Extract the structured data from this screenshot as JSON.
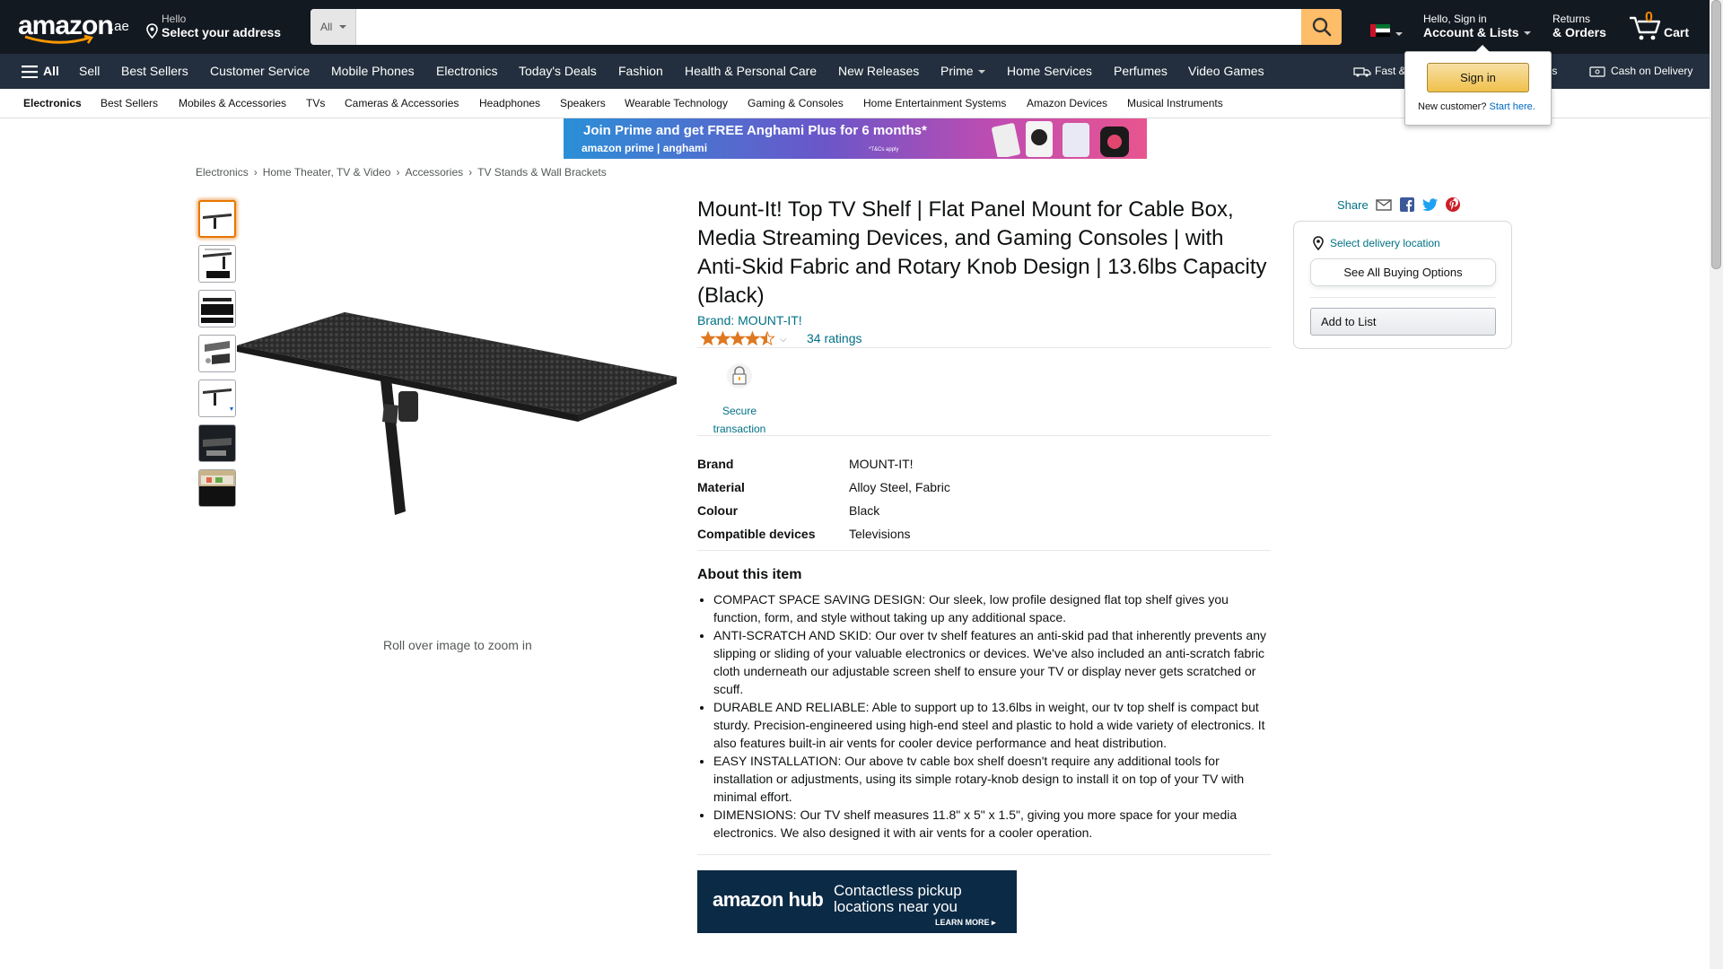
{
  "header": {
    "logo_text": "amazon",
    "logo_tld": ".ae",
    "deliver_hello": "Hello",
    "deliver_address": "Select your address",
    "search_category": "All",
    "search_placeholder": "",
    "account_hello": "Hello, Sign in",
    "account_lists": "Account & Lists",
    "returns_l1": "Returns",
    "returns_l2": "& Orders",
    "cart_count": "0",
    "cart_label": "Cart"
  },
  "main_nav": {
    "all_label": "All",
    "items": [
      "Sell",
      "Best Sellers",
      "Customer Service",
      "Mobile Phones",
      "Electronics",
      "Today's Deals",
      "Fashion",
      "Health & Personal Care",
      "New Releases",
      "Prime",
      "Home Services",
      "Perfumes",
      "Video Games"
    ],
    "fast_delivery": "Fast &",
    "returns_partial": "urns",
    "cash_on_delivery": "Cash on Delivery"
  },
  "subnav": {
    "items": [
      "Electronics",
      "Best Sellers",
      "Mobiles & Accessories",
      "TVs",
      "Cameras & Accessories",
      "Headphones",
      "Speakers",
      "Wearable Technology",
      "Gaming & Consoles",
      "Home Entertainment Systems",
      "Amazon Devices",
      "Musical Instruments"
    ]
  },
  "banner": {
    "line1": "Join Prime and get FREE Anghami Plus for 6 months*",
    "line2": "amazon prime | anghami",
    "terms": "*T&Cs apply"
  },
  "breadcrumb": [
    "Electronics",
    "Home Theater, TV & Video",
    "Accessories",
    "TV Stands & Wall Brackets"
  ],
  "product": {
    "title": "Mount-It! Top TV Shelf | Flat Panel Mount for Cable Box, Media Streaming Devices, and Gaming Consoles | with Anti-Skid Fabric and Rotary Knob Design | 13.6lbs Capacity (Black)",
    "brand_link": "Brand: MOUNT-IT!",
    "rating_value": 4.5,
    "rating_count": "34 ratings",
    "secure_label": "Secure transaction",
    "zoom_hint": "Roll over image to zoom in",
    "specs": [
      {
        "key": "Brand",
        "value": "MOUNT-IT!"
      },
      {
        "key": "Material",
        "value": "Alloy Steel, Fabric"
      },
      {
        "key": "Colour",
        "value": "Black"
      },
      {
        "key": "Compatible devices",
        "value": "Televisions"
      }
    ],
    "about_heading": "About this item",
    "about": [
      "COMPACT SPACE SAVING DESIGN: Our sleek, low profile designed flat top shelf gives you function, form, and style without taking up any additional space.",
      "ANTI-SCRATCH AND SKID: Our over tv shelf features an anti-skid pad that inherently prevents any slipping or sliding of your valuable electronics or devices. We've also included an anti-scratch fabric cloth underneath our adjustable screen shelf to ensure your TV or display never gets scratched or scuff.",
      "DURABLE AND RELIABLE: Able to support up to 13.6lbs in weight, our tv top shelf is compact but sturdy. Precision-engineered using high-end steel and plastic to hold a wide variety of electronics. It also features built-in air vents for cooler device performance and heat distribution.",
      "EASY INSTALLATION: Our above tv cable box shelf doesn't require any additional tools for installation or adjustments, using its simple rotary-knob design to install it on top of your TV with minimal effort.",
      "DIMENSIONS: Our TV shelf measures 11.8\" x 5\" x 1.5\", giving you more space for your media electronics. We also designed it with air vents for a cooler operation."
    ]
  },
  "hub_ad": {
    "brand": "amazon hub",
    "line1": "Contactless pickup",
    "line2": "locations near you",
    "cta": "LEARN MORE ▸"
  },
  "buybox": {
    "share_label": "Share",
    "delivery_location": "Select delivery location",
    "see_all_button": "See All Buying Options",
    "add_to_list": "Add to List"
  },
  "signin_flyout": {
    "button": "Sign in",
    "new_customer": "New customer?",
    "start_here": "Start here."
  },
  "colors": {
    "nav_dark": "#131921",
    "nav_secondary": "#232f3e",
    "search_button": "#febd69",
    "link": "#007185",
    "star": "#de7921",
    "cart_count": "#f08804"
  }
}
